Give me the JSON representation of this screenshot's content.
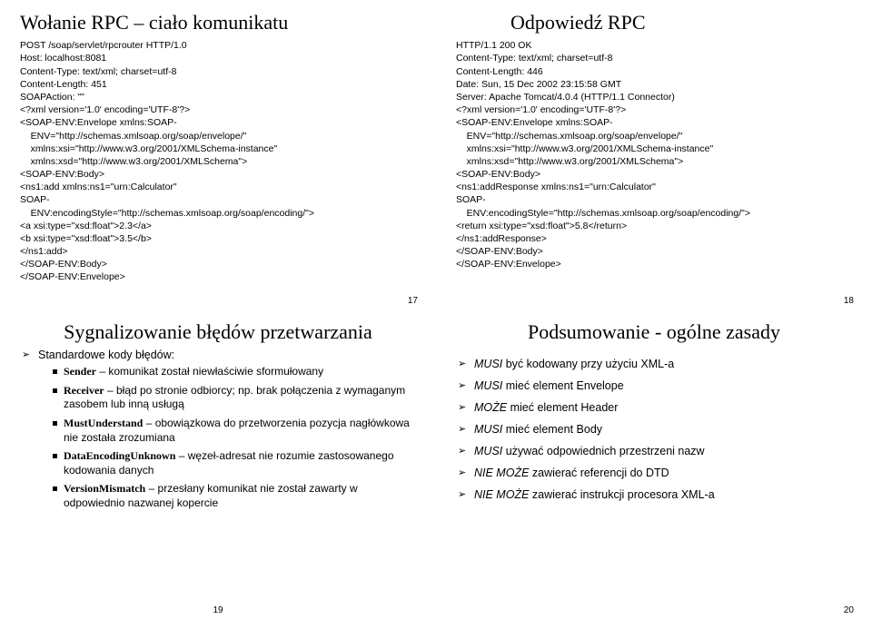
{
  "slide17": {
    "title": "Wołanie RPC – ciało komunikatu",
    "code": "POST /soap/servlet/rpcrouter HTTP/1.0\nHost: localhost:8081\nContent-Type: text/xml; charset=utf-8\nContent-Length: 451\nSOAPAction: \"\"\n<?xml version='1.0' encoding='UTF-8'?>\n<SOAP-ENV:Envelope xmlns:SOAP-\n    ENV=\"http://schemas.xmlsoap.org/soap/envelope/\"\n    xmlns:xsi=\"http://www.w3.org/2001/XMLSchema-instance\"\n    xmlns:xsd=\"http://www.w3.org/2001/XMLSchema\">\n<SOAP-ENV:Body>\n<ns1:add xmlns:ns1=\"urn:Calculator\"\nSOAP-\n    ENV:encodingStyle=\"http://schemas.xmlsoap.org/soap/encoding/\">\n<a xsi:type=\"xsd:float\">2.3</a>\n<b xsi:type=\"xsd:float\">3.5</b>\n</ns1:add>\n</SOAP-ENV:Body>\n</SOAP-ENV:Envelope>",
    "page": "17"
  },
  "slide18": {
    "title": "Odpowiedź RPC",
    "code": "HTTP/1.1 200 OK\nContent-Type: text/xml; charset=utf-8\nContent-Length: 446\nDate: Sun, 15 Dec 2002 23:15:58 GMT\nServer: Apache Tomcat/4.0.4 (HTTP/1.1 Connector)\n<?xml version='1.0' encoding='UTF-8'?>\n<SOAP-ENV:Envelope xmlns:SOAP-\n    ENV=\"http://schemas.xmlsoap.org/soap/envelope/\"\n    xmlns:xsi=\"http://www.w3.org/2001/XMLSchema-instance\"\n    xmlns:xsd=\"http://www.w3.org/2001/XMLSchema\">\n<SOAP-ENV:Body>\n<ns1:addResponse xmlns:ns1=\"urn:Calculator\"\nSOAP-\n    ENV:encodingStyle=\"http://schemas.xmlsoap.org/soap/encoding/\">\n<return xsi:type=\"xsd:float\">5.8</return>\n</ns1:addResponse>\n</SOAP-ENV:Body>\n</SOAP-ENV:Envelope>",
    "page": "18"
  },
  "slide19": {
    "title": "Sygnalizowanie błędów przetwarzania",
    "intro": "Standardowe kody błędów:",
    "items": [
      {
        "term": "Sender",
        "rest": " – komunikat został niewłaściwie sformułowany"
      },
      {
        "term": "Receiver",
        "rest": " – błąd po stronie odbiorcy; np. brak połączenia z wymaganym zasobem lub inną usługą"
      },
      {
        "term": "MustUnderstand",
        "rest": " – obowiązkowa do przetworzenia pozycja nagłówkowa nie została zrozumiana"
      },
      {
        "term": "DataEncodingUnknown",
        "rest": " – węzeł-adresat nie rozumie zastosowanego kodowania danych"
      },
      {
        "term": "VersionMismatch",
        "rest": " – przesłany komunikat nie został zawarty w odpowiednio nazwanej kopercie"
      }
    ],
    "page": "19"
  },
  "slide20": {
    "title": "Podsumowanie - ogólne zasady",
    "items": [
      {
        "pre": "MUSI",
        "rest": " być kodowany przy użyciu XML-a"
      },
      {
        "pre": "MUSI",
        "rest": " mieć element Envelope"
      },
      {
        "pre": "MOŻE",
        "rest": " mieć element Header"
      },
      {
        "pre": "MUSI",
        "rest": " mieć element Body"
      },
      {
        "pre": "MUSI",
        "rest": " używać odpowiednich przestrzeni nazw"
      },
      {
        "pre": "NIE MOŻE",
        "rest": " zawierać referencji do DTD"
      },
      {
        "pre": "NIE MOŻE",
        "rest": " zawierać instrukcji procesora XML-a"
      }
    ],
    "page": "20"
  }
}
